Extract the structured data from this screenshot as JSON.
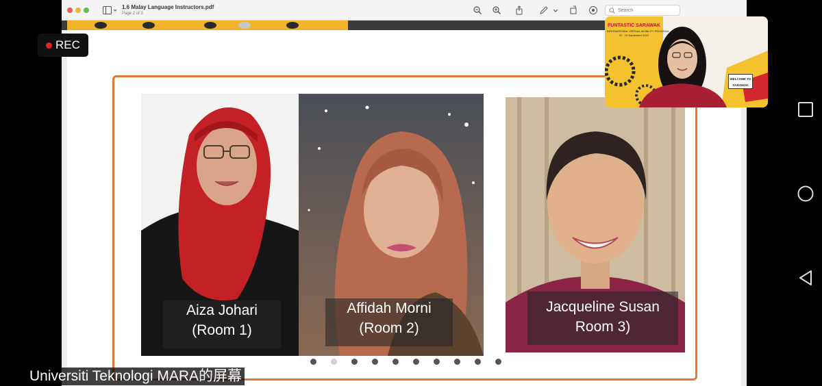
{
  "recording": {
    "label": "REC",
    "dot_color": "#e1261c"
  },
  "pdf": {
    "title": "1.6 Malay Language Instructors.pdf",
    "page_info": "Page 2 of 3",
    "search_placeholder": "Search"
  },
  "slide": {
    "frame_color": "#e27a34",
    "instructors": [
      {
        "name": "Aiza Johari",
        "room": "(Room 1)"
      },
      {
        "name": "Affidah Morni",
        "room": "(Room 2)"
      },
      {
        "name": "Jacqueline Susan",
        "room": "Room 3)"
      }
    ],
    "carousel": {
      "dot_count": 10
    }
  },
  "camera_tile": {
    "banner_title": "FUNTASTIC SARAWAK",
    "banner_subtitle": "INTERNATIONAL VIRTUAL MOBILITY PROGRAM",
    "dates": "22 - 24 September 2021",
    "sign_line1": "WELCOME TO",
    "sign_line2": "SARAWAK"
  },
  "screen_share_label": "Universiti Teknologi MARA的屏幕",
  "android_nav": {
    "recents": "square-icon",
    "home": "circle-icon",
    "back": "triangle-back-icon"
  }
}
